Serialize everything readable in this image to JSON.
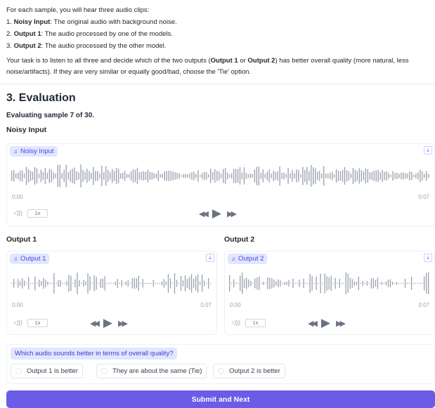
{
  "instructions": {
    "intro": "For each sample, you will hear three audio clips:",
    "items": [
      {
        "num": "1. ",
        "name": "Noisy Input",
        "desc": ": The original audio with background noise."
      },
      {
        "num": "2. ",
        "name": "Output 1",
        "desc": ": The audio processed by one of the models."
      },
      {
        "num": "3. ",
        "name": "Output 2",
        "desc": ": The audio processed by the other model."
      }
    ],
    "task_a": "Your task is to listen to all three and decide which of the two outputs (",
    "task_o1": "Output 1",
    "task_or": " or ",
    "task_o2": "Output 2",
    "task_b": ") has better overall quality (more natural, less noise/artifacts). If they are very similar or equally good/bad, choose the 'Tie' option."
  },
  "evaluation": {
    "heading": "3. Evaluation",
    "sample_info": "Evaluating sample 7 of 30.",
    "noisy_label": "Noisy Input"
  },
  "players": {
    "noisy": {
      "tag": "Noisy Input",
      "start": "0:00",
      "end": "0:07",
      "speed": "1x"
    },
    "out1": {
      "label": "Output 1",
      "tag": "Output 1",
      "start": "0:00",
      "end": "0:07",
      "speed": "1x"
    },
    "out2": {
      "label": "Output 2",
      "tag": "Output 2",
      "start": "0:00",
      "end": "0:07",
      "speed": "1x"
    }
  },
  "icons": {
    "note": "♫",
    "download": "⤓",
    "volume": "◁))",
    "rewind": "◀◀",
    "play": "▶",
    "forward": "▶▶"
  },
  "question": {
    "text": "Which audio sounds better in terms of overall quality?",
    "options": [
      "Output 1 is better",
      "They are about the same (Tie)",
      "Output 2 is better"
    ]
  },
  "submit_label": "Submit and Next",
  "colors": {
    "accent": "#6b5ce7",
    "tag_bg": "#e0e7ff",
    "wave": "#9ca3af"
  }
}
